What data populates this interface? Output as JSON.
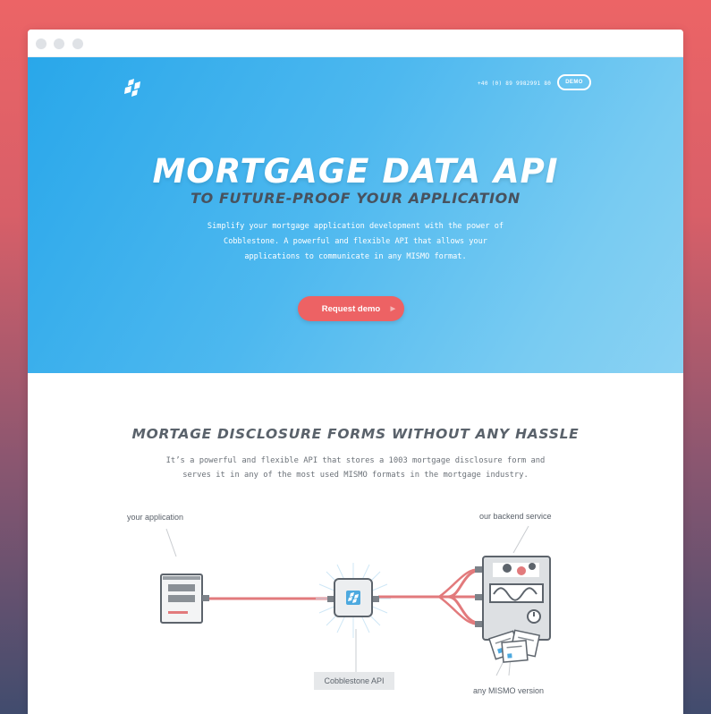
{
  "browser": {
    "controls": [
      "close-dot",
      "minimize-dot",
      "maximize-dot"
    ]
  },
  "header": {
    "phone": "+40 (0) 89 9982991 80",
    "demo_label": "DEMO"
  },
  "hero": {
    "title": "MORTGAGE DATA API",
    "subtitle": "TO FUTURE-PROOF YOUR APPLICATION",
    "description": "Simplify your mortgage application development with the power of Cobblestone. A powerful and flexible API that allows  your applications to communicate in any MISMO format.",
    "cta_label": "Request demo"
  },
  "features": {
    "title": "MORTAGE DISCLOSURE FORMS WITHOUT ANY HASSLE",
    "description": "It’s a powerful and flexible API that stores a 1003 mortgage disclosure form and serves it in any of the most used MISMO formats in the mortgage industry."
  },
  "diagram": {
    "label_app": "your application",
    "label_backend": "our backend service",
    "label_api": "Cobblestone API",
    "label_mismo": "any MISMO version"
  },
  "colors": {
    "accent": "#ed6264",
    "hero_start": "#29a7ea",
    "hero_end": "#8ad2f3",
    "heading_dark": "#48525e",
    "wire": "#e27a7c"
  }
}
